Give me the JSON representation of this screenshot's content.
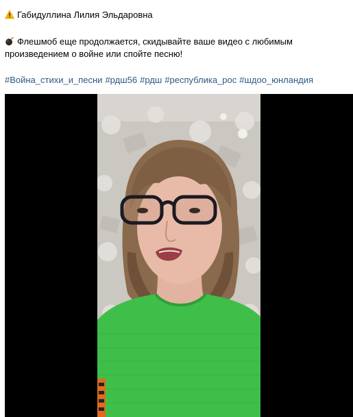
{
  "post": {
    "author_line": "Габидуллина Лилия Эльдаровна",
    "author_icon": "warning-icon",
    "body_icon": "bomb-icon",
    "body_line_1": "Флешмоб еще продолжается, скидывайте ваше видео с любимым",
    "body_line_2": "произведением о войне или спойте песню!",
    "hashtags": [
      "#Война_стихи_и_песни",
      "#рдш56",
      "#рдш",
      "#республика_рос",
      "#шдоо_юнландия"
    ],
    "link_color": "#2a5885"
  },
  "video": {
    "content": "woman-with-glasses-green-sweater"
  }
}
